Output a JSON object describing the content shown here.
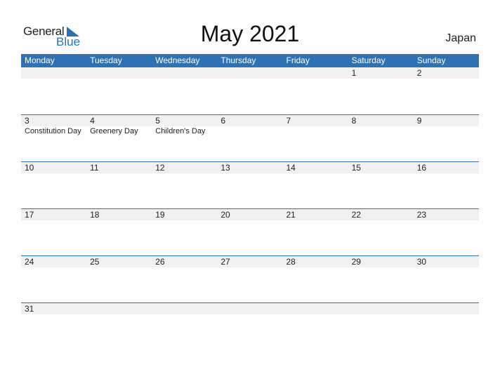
{
  "logo": {
    "general": "General",
    "blue": "Blue"
  },
  "title": "May 2021",
  "country": "Japan",
  "colors": {
    "accent": "#2e72b3",
    "row_bg": "#f1f1f1"
  },
  "weekdays": [
    "Monday",
    "Tuesday",
    "Wednesday",
    "Thursday",
    "Friday",
    "Saturday",
    "Sunday"
  ],
  "weeks": [
    {
      "days": [
        "",
        "",
        "",
        "",
        "",
        "1",
        "2"
      ],
      "holidays": [
        "",
        "",
        "",
        "",
        "",
        "",
        ""
      ]
    },
    {
      "days": [
        "3",
        "4",
        "5",
        "6",
        "7",
        "8",
        "9"
      ],
      "holidays": [
        "Constitution Day",
        "Greenery Day",
        "Children's Day",
        "",
        "",
        "",
        ""
      ]
    },
    {
      "days": [
        "10",
        "11",
        "12",
        "13",
        "14",
        "15",
        "16"
      ],
      "holidays": [
        "",
        "",
        "",
        "",
        "",
        "",
        ""
      ]
    },
    {
      "days": [
        "17",
        "18",
        "19",
        "20",
        "21",
        "22",
        "23"
      ],
      "holidays": [
        "",
        "",
        "",
        "",
        "",
        "",
        ""
      ]
    },
    {
      "days": [
        "24",
        "25",
        "26",
        "27",
        "28",
        "29",
        "30"
      ],
      "holidays": [
        "",
        "",
        "",
        "",
        "",
        "",
        ""
      ]
    },
    {
      "days": [
        "31",
        "",
        "",
        "",
        "",
        "",
        ""
      ],
      "holidays": [
        "",
        "",
        "",
        "",
        "",
        "",
        ""
      ]
    }
  ]
}
